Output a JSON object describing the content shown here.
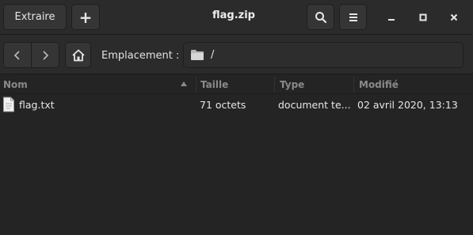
{
  "header": {
    "extract_label": "Extraire",
    "add_label": "+",
    "title": "flag.zip"
  },
  "location": {
    "label": "Emplacement :",
    "path": "/"
  },
  "columns": [
    "Nom",
    "Taille",
    "Type",
    "Modifié"
  ],
  "files": [
    {
      "name": "flag.txt",
      "size": "71 octets",
      "type": "document te...",
      "modified": "02 avril 2020, 13:13",
      "icon": "text-file-icon"
    }
  ]
}
